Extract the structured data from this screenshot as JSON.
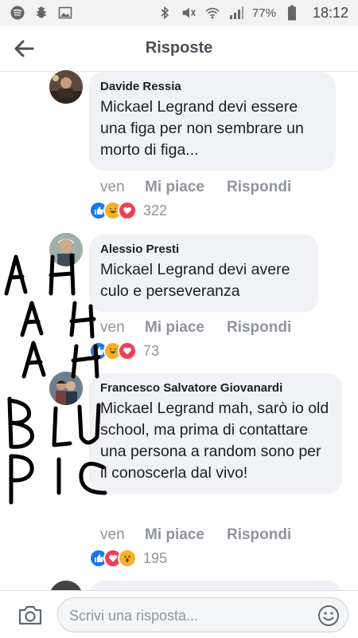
{
  "statusbar": {
    "left_icons": [
      "spotify-icon",
      "bug-icon",
      "image-icon"
    ],
    "right_icons": [
      "bluetooth-icon",
      "mute-icon",
      "wifi-icon",
      "signal-icon"
    ],
    "battery": "77%",
    "time": "18:12"
  },
  "header": {
    "title": "Risposte"
  },
  "comments": [
    {
      "author": "Davide Ressia",
      "text": "Mickael Legrand devi essere una figa per non sembrare un morto di figa...",
      "time": "ven",
      "like": "Mi piace",
      "reply": "Rispondi",
      "reaction_count": "322",
      "reactions": [
        "like",
        "haha",
        "love"
      ]
    },
    {
      "author": "Alessio Presti",
      "text": "Mickael Legrand devi avere culo e perseveranza",
      "time": "ven",
      "like": "Mi piace",
      "reply": "Rispondi",
      "reaction_count": "73",
      "reactions": [
        "like",
        "haha",
        "love"
      ]
    },
    {
      "author": "Francesco Salvatore Giovanardi",
      "text": "Mickael Legrand mah, sarò io old school, ma prima di contattare una persona a random sono per il conoscerla dal vivo!",
      "time": "ven",
      "like": "Mi piace",
      "reply": "Rispondi",
      "reaction_count": "195",
      "reactions": [
        "like",
        "love",
        "wow"
      ]
    }
  ],
  "handwriting": [
    "A H",
    "A H",
    "A H",
    "B L U",
    "P I C"
  ],
  "composer": {
    "placeholder": "Scrivi una risposta..."
  },
  "colors": {
    "like": "#1877f2",
    "love": "#f33e58",
    "haha": "#f7b125",
    "meta": "#90949c",
    "bubble": "#f0f2f5"
  }
}
